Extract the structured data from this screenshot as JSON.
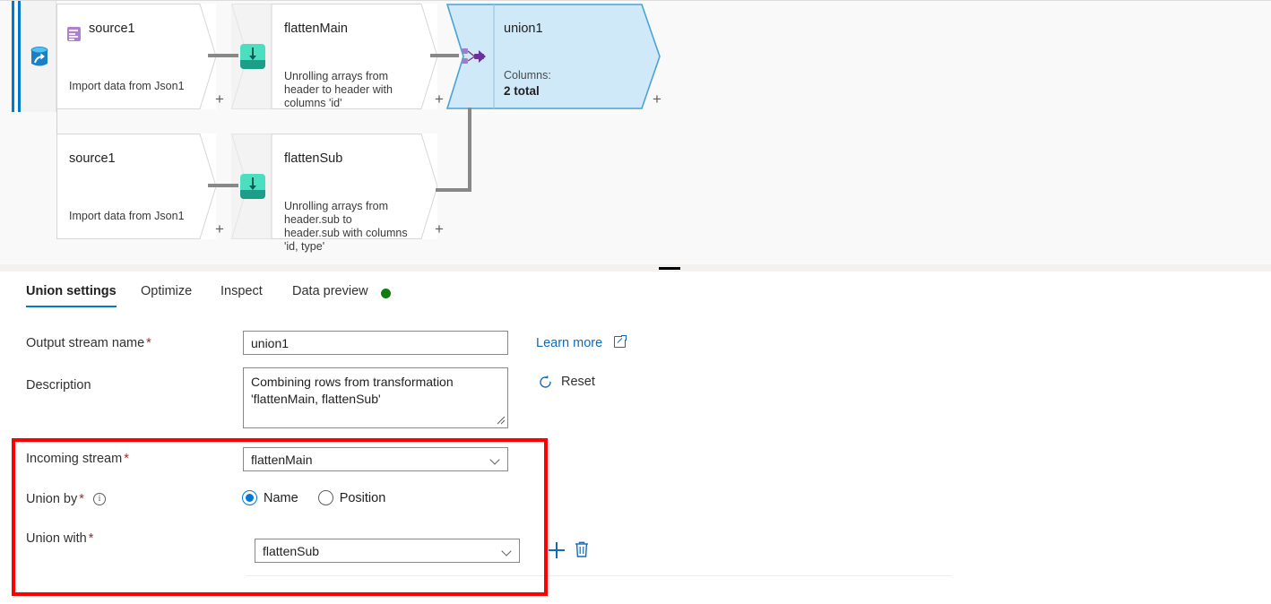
{
  "canvas": {
    "source_panel_icon": "database-arrow-icon",
    "nodes": [
      {
        "id": "source-top",
        "title": "source1",
        "subtitle": "Import data from Json1",
        "icon": "json-file-icon",
        "add_label": "+"
      },
      {
        "id": "flatten-main",
        "title": "flattenMain",
        "subtitle": "Unrolling arrays from header to header with columns 'id'",
        "icon": "flatten-icon",
        "add_label": "+"
      },
      {
        "id": "source-bottom",
        "title": "source1",
        "subtitle": "Import data from Json1",
        "icon": "",
        "add_label": "+"
      },
      {
        "id": "flatten-sub",
        "title": "flattenSub",
        "subtitle": "Unrolling arrays from header.sub to header.sub with columns 'id, type'",
        "icon": "flatten-icon",
        "add_label": "+"
      }
    ],
    "union_node": {
      "title": "union1",
      "columns_label": "Columns:",
      "columns_value": "2 total",
      "icon": "union-merge-icon",
      "add_label": "+",
      "selected": true,
      "fill": "#cfe9f9",
      "border": "#4aa3d4"
    }
  },
  "tabs": [
    {
      "label": "Union settings",
      "active": true
    },
    {
      "label": "Optimize",
      "active": false
    },
    {
      "label": "Inspect",
      "active": false
    },
    {
      "label": "Data preview",
      "active": false,
      "status_dot": "#107c10"
    }
  ],
  "form": {
    "output_stream_name": {
      "label": "Output stream name",
      "required": "*",
      "value": "union1"
    },
    "description": {
      "label": "Description",
      "value": "Combining rows from transformation 'flattenMain, flattenSub'"
    },
    "learn_more": {
      "label": "Learn more",
      "icon": "external-link-icon"
    },
    "reset": {
      "label": "Reset",
      "icon": "refresh-circular-arrow-icon"
    },
    "incoming_stream": {
      "label": "Incoming stream",
      "required": "*",
      "value": "flattenMain"
    },
    "union_by": {
      "label": "Union by",
      "required": "*",
      "info_icon": "info-circle-icon",
      "options": [
        {
          "label": "Name",
          "selected": true
        },
        {
          "label": "Position",
          "selected": false
        }
      ]
    },
    "union_with": {
      "label": "Union with",
      "required": "*",
      "value": "flattenSub",
      "add_icon": "plus-icon",
      "delete_icon": "trash-icon"
    }
  },
  "highlight": {
    "color": "#ff0000"
  }
}
